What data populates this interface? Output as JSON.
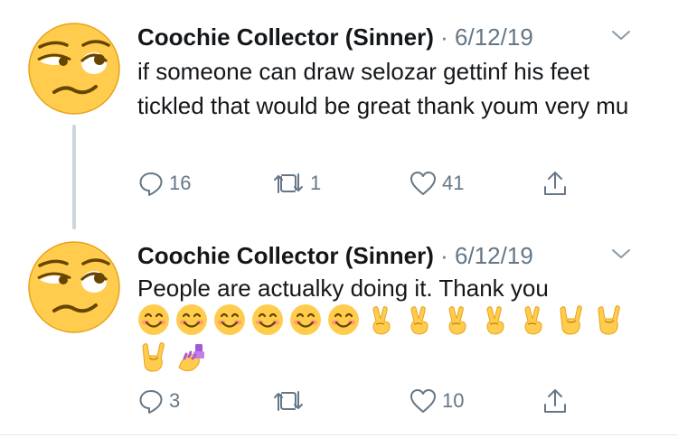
{
  "tweets": [
    {
      "author": "Coochie Collector (Sinner)",
      "meta": " · 6/12/19",
      "text": "if someone can draw selozar gettinf his feet tickled that would be great thank youm very mu",
      "replies": "16",
      "retweets": "1",
      "likes": "41"
    },
    {
      "author": "Coochie Collector (Sinner)",
      "meta": " · 6/12/19",
      "text": "People are actualky doing it. Thank you",
      "emoji_row_1": [
        "smiling-face",
        "smiling-face",
        "smiling-face",
        "smiling-face",
        "smiling-face",
        "smiling-face",
        "victory-hand",
        "victory-hand",
        "victory-hand",
        "victory-hand",
        "victory-hand",
        "sign-of-horns",
        "sign-of-horns"
      ],
      "emoji_row_2": [
        "sign-of-horns",
        "nail-polish"
      ],
      "replies": "3",
      "retweets": "",
      "likes": "10"
    }
  ],
  "icons": {
    "avatar": "face-with-rolling-eyes-icon",
    "menu": "chevron-down-icon",
    "reply": "reply-icon",
    "retweet": "retweet-icon",
    "like": "heart-icon",
    "share": "share-icon"
  },
  "colors": {
    "text": "#14171a",
    "secondary": "#657786",
    "thread_line": "#ccd6dd",
    "emoji_yellow": "#ffcc4d"
  }
}
